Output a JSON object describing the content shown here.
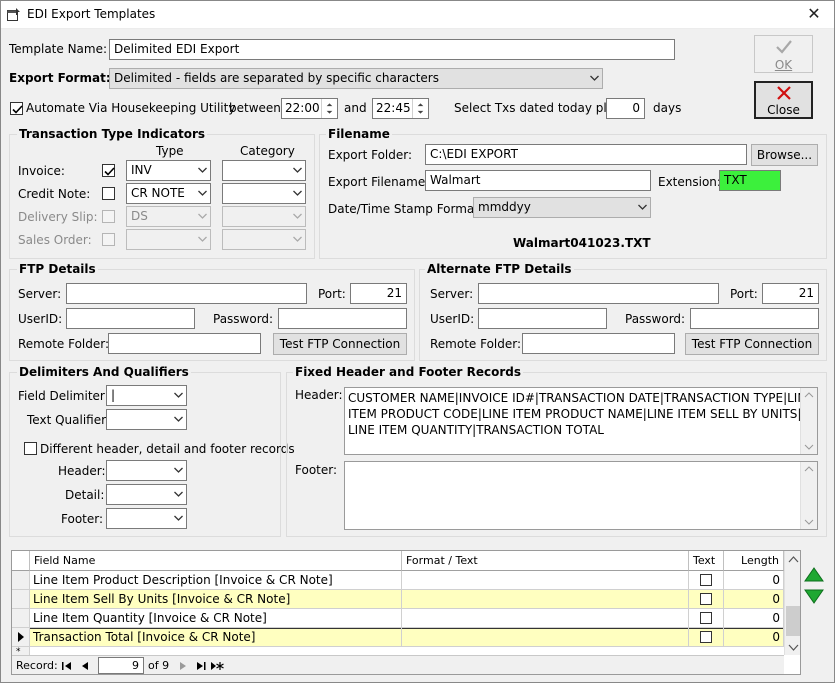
{
  "window": {
    "title": "EDI Export Templates"
  },
  "buttons": {
    "ok": "OK",
    "close": "Close",
    "browse": "Browse...",
    "test_ftp": "Test FTP Connection",
    "test_alt_ftp": "Test FTP Connection"
  },
  "template": {
    "name_label": "Template Name:",
    "name_value": "Delimited EDI Export"
  },
  "export_format": {
    "label": "Export Format:",
    "value": "Delimited - fields are separated by specific characters"
  },
  "automate": {
    "label": "Automate Via Housekeeping Utility",
    "checked": true,
    "between_label": "between",
    "from": "22:00",
    "and_label": "and",
    "to": "22:45",
    "select_label": "Select Txs dated today plus",
    "days_value": "0",
    "days_label": "days"
  },
  "transaction_types": {
    "title": "Transaction Type Indicators",
    "type_header": "Type",
    "category_header": "Category",
    "rows": [
      {
        "label": "Invoice:",
        "checked": true,
        "enabled": true,
        "type": "INV",
        "category": ""
      },
      {
        "label": "Credit Note:",
        "checked": false,
        "enabled": true,
        "type": "CR NOTE",
        "category": ""
      },
      {
        "label": "Delivery Slip:",
        "checked": false,
        "enabled": false,
        "type": "DS",
        "category": ""
      },
      {
        "label": "Sales Order:",
        "checked": false,
        "enabled": false,
        "type": "",
        "category": ""
      }
    ]
  },
  "filename": {
    "title": "Filename",
    "folder_label": "Export Folder:",
    "folder_value": "C:\\EDI EXPORT",
    "file_label": "Export Filename:",
    "file_value": "Walmart",
    "ext_label": "Extension:",
    "ext_value": "TXT",
    "ext_color": "#3cf03c",
    "stamp_label": "Date/Time Stamp Format:",
    "stamp_value": "mmddyy",
    "preview": "Walmart041023.TXT"
  },
  "ftp": {
    "title": "FTP Details",
    "server_label": "Server:",
    "server_value": "",
    "port_label": "Port:",
    "port_value": "21",
    "user_label": "UserID:",
    "user_value": "",
    "password_label": "Password:",
    "password_value": "",
    "folder_label": "Remote Folder:",
    "folder_value": ""
  },
  "alt_ftp": {
    "title": "Alternate FTP Details",
    "server_label": "Server:",
    "server_value": "",
    "port_label": "Port:",
    "port_value": "21",
    "user_label": "UserID:",
    "user_value": "",
    "password_label": "Password:",
    "password_value": "",
    "folder_label": "Remote Folder:",
    "folder_value": ""
  },
  "delimiters": {
    "title": "Delimiters And Qualifiers",
    "field_label": "Field Delimiter:",
    "field_value": "|",
    "text_label": "Text Qualifier:",
    "text_value": "",
    "diff_label": "Different header, detail and footer records",
    "diff_checked": false,
    "header_label": "Header:",
    "detail_label": "Detail:",
    "footer_label": "Footer:"
  },
  "fixed_records": {
    "title": "Fixed Header and Footer Records",
    "header_label": "Header:",
    "header_value": "CUSTOMER NAME|INVOICE ID#|TRANSACTION DATE|TRANSACTION TYPE|LINE ITEM PRODUCT CODE|LINE ITEM PRODUCT NAME|LINE ITEM SELL BY UNITS|LINE ITEM QUANTITY|TRANSACTION TOTAL",
    "header_lines": [
      "CUSTOMER NAME|INVOICE ID#|TRANSACTION DATE|TRANSACTION TYPE|LINE",
      "ITEM PRODUCT CODE|LINE ITEM PRODUCT NAME|LINE ITEM SELL BY UNITS|",
      "LINE ITEM QUANTITY|TRANSACTION TOTAL"
    ],
    "footer_label": "Footer:",
    "footer_value": ""
  },
  "grid": {
    "columns": [
      "Field Name",
      "Format / Text",
      "Text",
      "Length"
    ],
    "highlight_color": "#ffffc0",
    "rows": [
      {
        "name": "Line Item Product Description [Invoice & CR Note]",
        "format": "",
        "text": false,
        "length": "0",
        "highlight": false,
        "current": false
      },
      {
        "name": "Line Item Sell By Units [Invoice & CR Note]",
        "format": "",
        "text": false,
        "length": "0",
        "highlight": true,
        "current": false
      },
      {
        "name": "Line Item Quantity [Invoice & CR Note]",
        "format": "",
        "text": false,
        "length": "0",
        "highlight": false,
        "current": false
      },
      {
        "name": "Transaction Total [Invoice & CR Note]",
        "format": "",
        "text": false,
        "length": "0",
        "highlight": true,
        "current": true
      }
    ],
    "nav": {
      "record_label": "Record:",
      "current": "9",
      "of_label": "of 9"
    }
  }
}
